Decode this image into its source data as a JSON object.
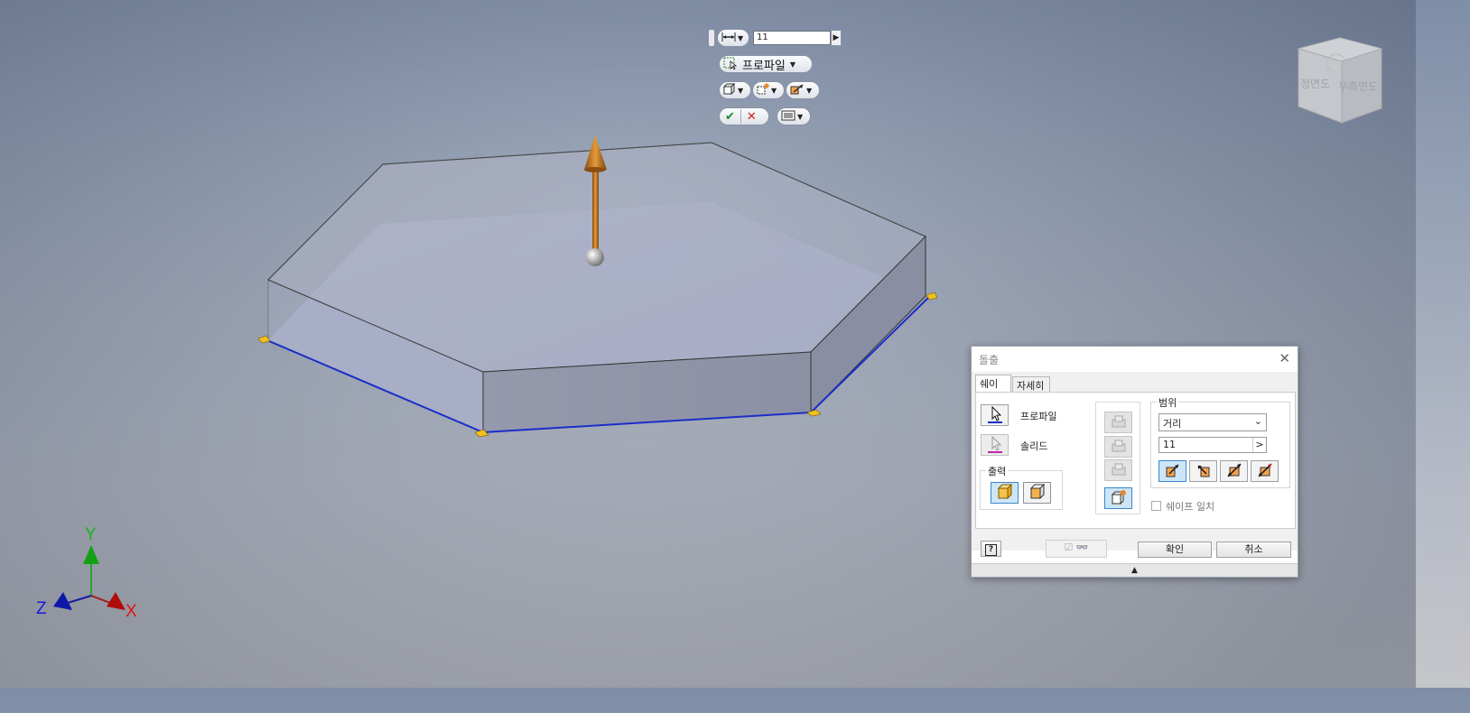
{
  "mini_toolbar": {
    "distance_value": "11",
    "profile_label": "프로파일"
  },
  "viewcube": {
    "front_label": "정면도",
    "right_label": "우측면도"
  },
  "triad": {
    "x": "X",
    "y": "Y",
    "z": "Z"
  },
  "dialog": {
    "title": "돌출",
    "tabs": [
      "쉐이프",
      "자세히"
    ],
    "profile_label": "프로파일",
    "solid_label": "솔리드",
    "output_label": "출력",
    "extent_label": "범위",
    "extent_type": "거리",
    "distance_value": "11",
    "match_shape_label": "쉐이프 일치",
    "ok_label": "확인",
    "cancel_label": "취소"
  },
  "colors": {
    "accent_orange": "#c8781c",
    "sketch_blue": "#1a2fc8",
    "selection_blue": "#3b86c7",
    "cancel_red": "#d11b1b",
    "ok_green": "#1f8a2a"
  }
}
